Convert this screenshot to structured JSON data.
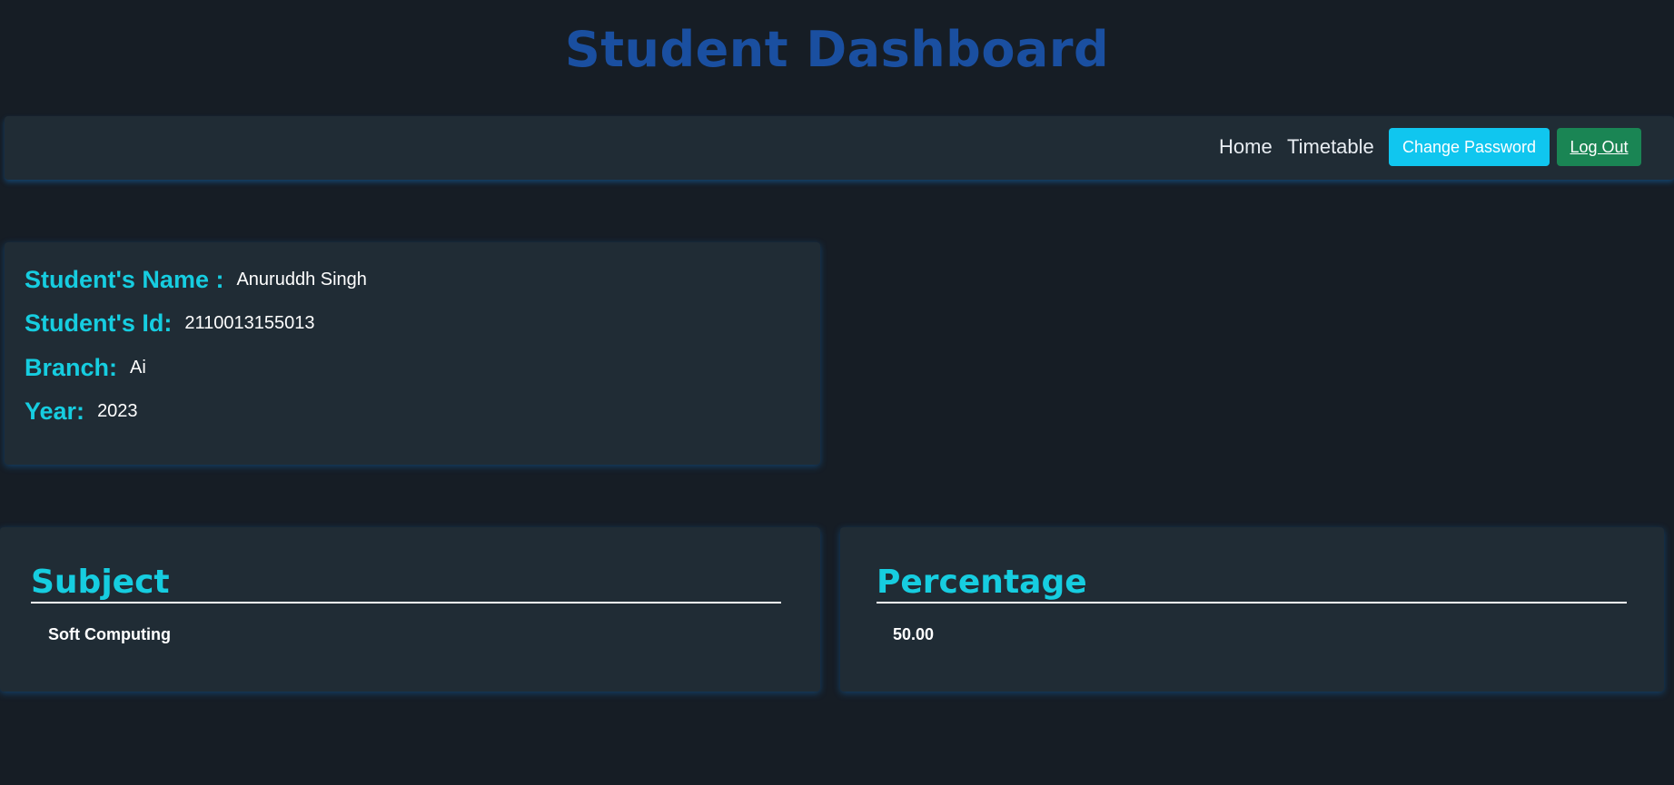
{
  "header": {
    "title": "Student Dashboard"
  },
  "nav": {
    "home": "Home",
    "timetable": "Timetable",
    "change_password": "Change Password",
    "logout": "Log Out"
  },
  "student": {
    "name_label": "Student's Name :",
    "name_value": "Anuruddh Singh",
    "id_label": "Student's Id:",
    "id_value": "2110013155013",
    "branch_label": "Branch:",
    "branch_value": "Ai",
    "year_label": "Year:",
    "year_value": "2023"
  },
  "results": {
    "subject_header": "Subject",
    "percentage_header": "Percentage",
    "rows": [
      {
        "subject": "Soft Computing",
        "percentage": "50.00"
      }
    ]
  },
  "colors": {
    "background": "#161d25",
    "card": "#202c35",
    "title": "#1a4fa0",
    "accent": "#16cde0",
    "change_password_button": "#10c6ef",
    "logout_button": "#1a8554"
  }
}
